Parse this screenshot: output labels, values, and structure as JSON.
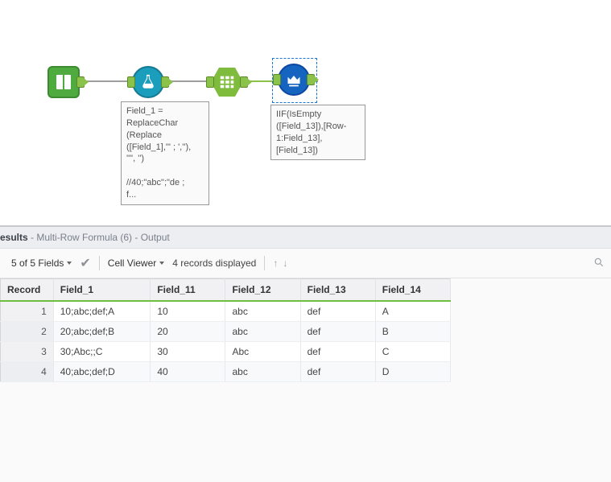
{
  "canvas": {
    "tools": {
      "input": "Input",
      "formula": "Formula",
      "text_to_columns": "Text To Columns",
      "multirow": "Multi-Row Formula"
    },
    "annotations": {
      "formula": "Field_1 = \nReplaceChar\n(Replace\n([Field_1],'\" ; ',''), \n'\"', '')\n\n//40;\"abc\";\"de ;\nf...",
      "multirow": "IIF(IsEmpty\n([Field_13]),[Row-\n1:Field_13],\n[Field_13])"
    }
  },
  "results": {
    "header": {
      "title": "esults",
      "source": " - Multi-Row Formula (6) - Output"
    },
    "toolbar": {
      "fields": "5 of 5 Fields",
      "cellviewer": "Cell Viewer",
      "records": "4 records displayed"
    },
    "columns": [
      "Record",
      "Field_1",
      "Field_11",
      "Field_12",
      "Field_13",
      "Field_14"
    ],
    "rows": [
      {
        "n": "1",
        "c": [
          "10;abc;def;A",
          "10",
          "abc",
          "def",
          "A"
        ]
      },
      {
        "n": "2",
        "c": [
          "20;abc;def;B",
          "20",
          "abc",
          "def",
          "B"
        ]
      },
      {
        "n": "3",
        "c": [
          "30;Abc;;C",
          "30",
          "Abc",
          "def",
          "C"
        ]
      },
      {
        "n": "4",
        "c": [
          "40;abc;def;D",
          "40",
          "abc",
          "def",
          "D"
        ]
      }
    ]
  }
}
